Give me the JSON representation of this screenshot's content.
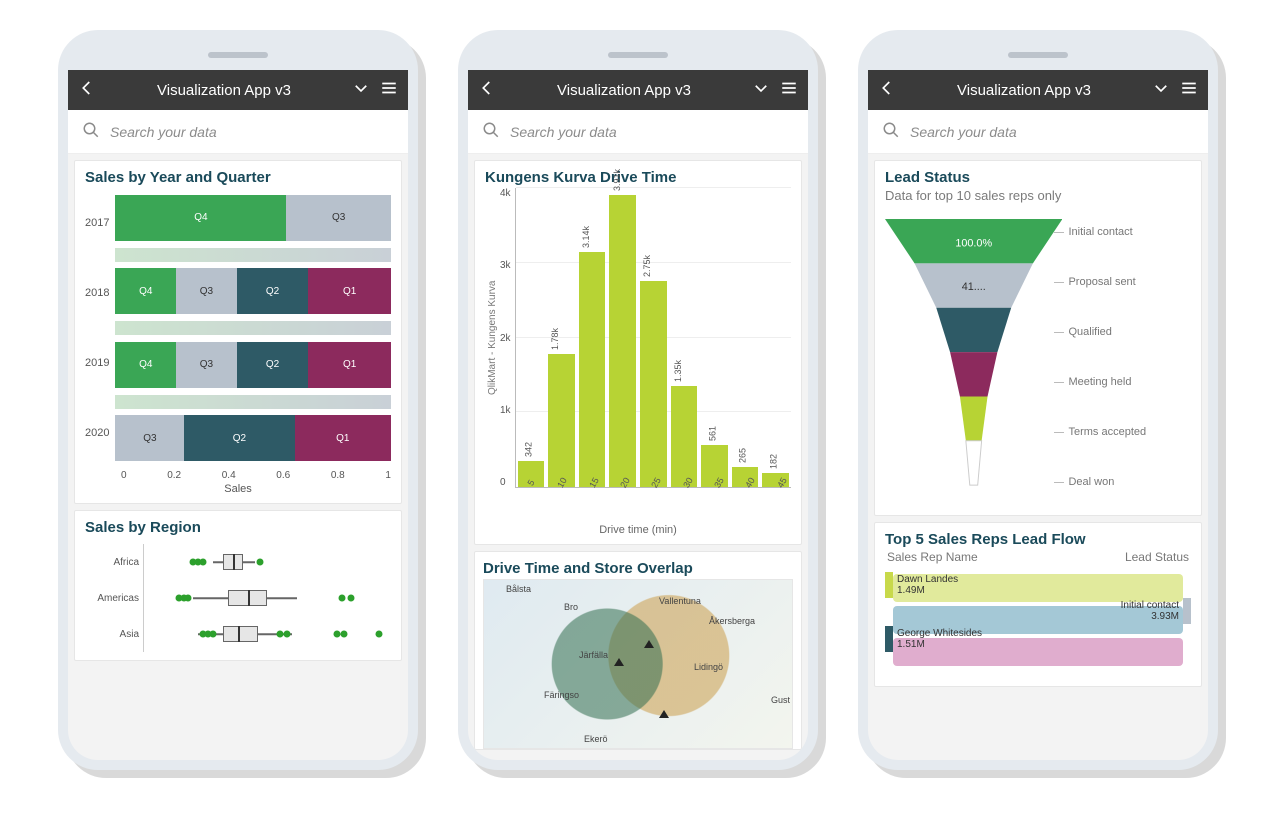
{
  "app": {
    "title": "Visualization App v3"
  },
  "search": {
    "placeholder": "Search your data"
  },
  "phone1": {
    "chart1": {
      "title": "Sales by Year and Quarter",
      "xlabel": "Sales",
      "xticks": [
        "0",
        "0.2",
        "0.4",
        "0.6",
        "0.8",
        "1"
      ],
      "years": [
        "2017",
        "2018",
        "2019",
        "2020"
      ]
    },
    "chart2": {
      "title": "Sales by Region",
      "rows": [
        "Africa",
        "Americas",
        "Asia"
      ]
    }
  },
  "phone2": {
    "chart1": {
      "title": "Kungens Kurva Drive Time",
      "ylabel": "QlikMart - Kungens Kurva",
      "xlabel": "Drive time (min)",
      "yticks": [
        "4k",
        "3k",
        "2k",
        "1k",
        "0"
      ],
      "labels": [
        "342",
        "1.78k",
        "3.14k",
        "3.91k",
        "2.75k",
        "1.35k",
        "561",
        "265",
        "182"
      ],
      "xticks": [
        "5",
        "10",
        "15",
        "20",
        "25",
        "30",
        "35",
        "40",
        "45"
      ]
    },
    "chart2": {
      "title": "Drive Time and Store Overlap",
      "places": [
        "Bålsta",
        "Bro",
        "Vallentuna",
        "Åkersberga",
        "Järfälla",
        "Lidingö",
        "Färingso",
        "Gust",
        "Ekerö"
      ]
    }
  },
  "phone3": {
    "chart1": {
      "title": "Lead Status",
      "subtitle": "Data for top 10 sales reps only",
      "stages": [
        "Initial contact",
        "Proposal sent",
        "Qualified",
        "Meeting held",
        "Terms accepted",
        "Deal won"
      ],
      "pct_top": "100.0%",
      "pct_2": "41...."
    },
    "chart2": {
      "title": "Top 5 Sales Reps Lead Flow",
      "left_header": "Sales Rep Name",
      "right_header": "Lead Status",
      "rep1_name": "Dawn Landes",
      "rep1_val": "1.49M",
      "rep2_name": "George Whitesides",
      "rep2_val": "1.51M",
      "right_name": "Initial contact",
      "right_val": "3.93M"
    }
  },
  "chart_data": [
    {
      "type": "bar",
      "orientation": "stacked-horizontal",
      "title": "Sales by Year and Quarter",
      "xlabel": "Sales",
      "xlim": [
        0,
        1
      ],
      "categories": [
        "2017",
        "2018",
        "2019",
        "2020"
      ],
      "series": [
        {
          "year": "2017",
          "segments": [
            {
              "q": "Q4",
              "w": 0.62,
              "color": "#3aa655"
            },
            {
              "q": "Q3",
              "w": 0.38,
              "color": "#b7c1cc"
            }
          ]
        },
        {
          "year": "2018",
          "segments": [
            {
              "q": "Q4",
              "w": 0.22,
              "color": "#3aa655"
            },
            {
              "q": "Q3",
              "w": 0.22,
              "color": "#b7c1cc"
            },
            {
              "q": "Q2",
              "w": 0.26,
              "color": "#2e5a66"
            },
            {
              "q": "Q1",
              "w": 0.3,
              "color": "#8c2a5d"
            }
          ]
        },
        {
          "year": "2019",
          "segments": [
            {
              "q": "Q4",
              "w": 0.22,
              "color": "#3aa655"
            },
            {
              "q": "Q3",
              "w": 0.22,
              "color": "#b7c1cc"
            },
            {
              "q": "Q2",
              "w": 0.26,
              "color": "#2e5a66"
            },
            {
              "q": "Q1",
              "w": 0.3,
              "color": "#8c2a5d"
            }
          ]
        },
        {
          "year": "2020",
          "segments": [
            {
              "q": "Q3",
              "w": 0.25,
              "color": "#b7c1cc"
            },
            {
              "q": "Q2",
              "w": 0.4,
              "color": "#2e5a66"
            },
            {
              "q": "Q1",
              "w": 0.35,
              "color": "#8c2a5d"
            }
          ]
        }
      ]
    },
    {
      "type": "boxplot",
      "title": "Sales by Region",
      "rows": [
        {
          "name": "Africa",
          "whisker": [
            0.28,
            0.45
          ],
          "box": [
            0.32,
            0.4
          ],
          "median": 0.36,
          "outliers": [
            0.2,
            0.22,
            0.24,
            0.47
          ]
        },
        {
          "name": "Americas",
          "whisker": [
            0.2,
            0.62
          ],
          "box": [
            0.34,
            0.5
          ],
          "median": 0.42,
          "outliers": [
            0.14,
            0.16,
            0.18,
            0.8,
            0.84
          ]
        },
        {
          "name": "Asia",
          "whisker": [
            0.22,
            0.6
          ],
          "box": [
            0.32,
            0.46
          ],
          "median": 0.38,
          "outliers": [
            0.24,
            0.26,
            0.28,
            0.55,
            0.58,
            0.78,
            0.81,
            0.95
          ]
        }
      ]
    },
    {
      "type": "bar",
      "title": "Kungens Kurva Drive Time",
      "xlabel": "Drive time (min)",
      "ylabel": "QlikMart - Kungens Kurva",
      "ylim": [
        0,
        4000
      ],
      "x": [
        5,
        10,
        15,
        20,
        25,
        30,
        35,
        40,
        45
      ],
      "values": [
        342,
        1780,
        3140,
        3910,
        2750,
        1350,
        561,
        265,
        182
      ]
    },
    {
      "type": "funnel",
      "title": "Lead Status",
      "stages": [
        {
          "name": "Initial contact",
          "pct": 100.0,
          "color": "#3aa655"
        },
        {
          "name": "Proposal sent",
          "pct": 41,
          "color": "#b7c1cc"
        },
        {
          "name": "Qualified",
          "pct": 30,
          "color": "#2e5a66"
        },
        {
          "name": "Meeting held",
          "pct": 22,
          "color": "#8c2a5d"
        },
        {
          "name": "Terms accepted",
          "pct": 14,
          "color": "#b7d334"
        },
        {
          "name": "Deal won",
          "pct": 8,
          "color": "#ffffff"
        }
      ]
    },
    {
      "type": "sankey",
      "title": "Top 5 Sales Reps Lead Flow",
      "left": [
        {
          "name": "Dawn Landes",
          "value": 1.49,
          "color": "#c8d94a"
        },
        {
          "name": "George Whitesides",
          "value": 1.51,
          "color": "#2e5a66"
        }
      ],
      "right": [
        {
          "name": "Initial contact",
          "value": 3.93,
          "color": "#b7c1cc"
        }
      ],
      "unit": "M"
    }
  ]
}
